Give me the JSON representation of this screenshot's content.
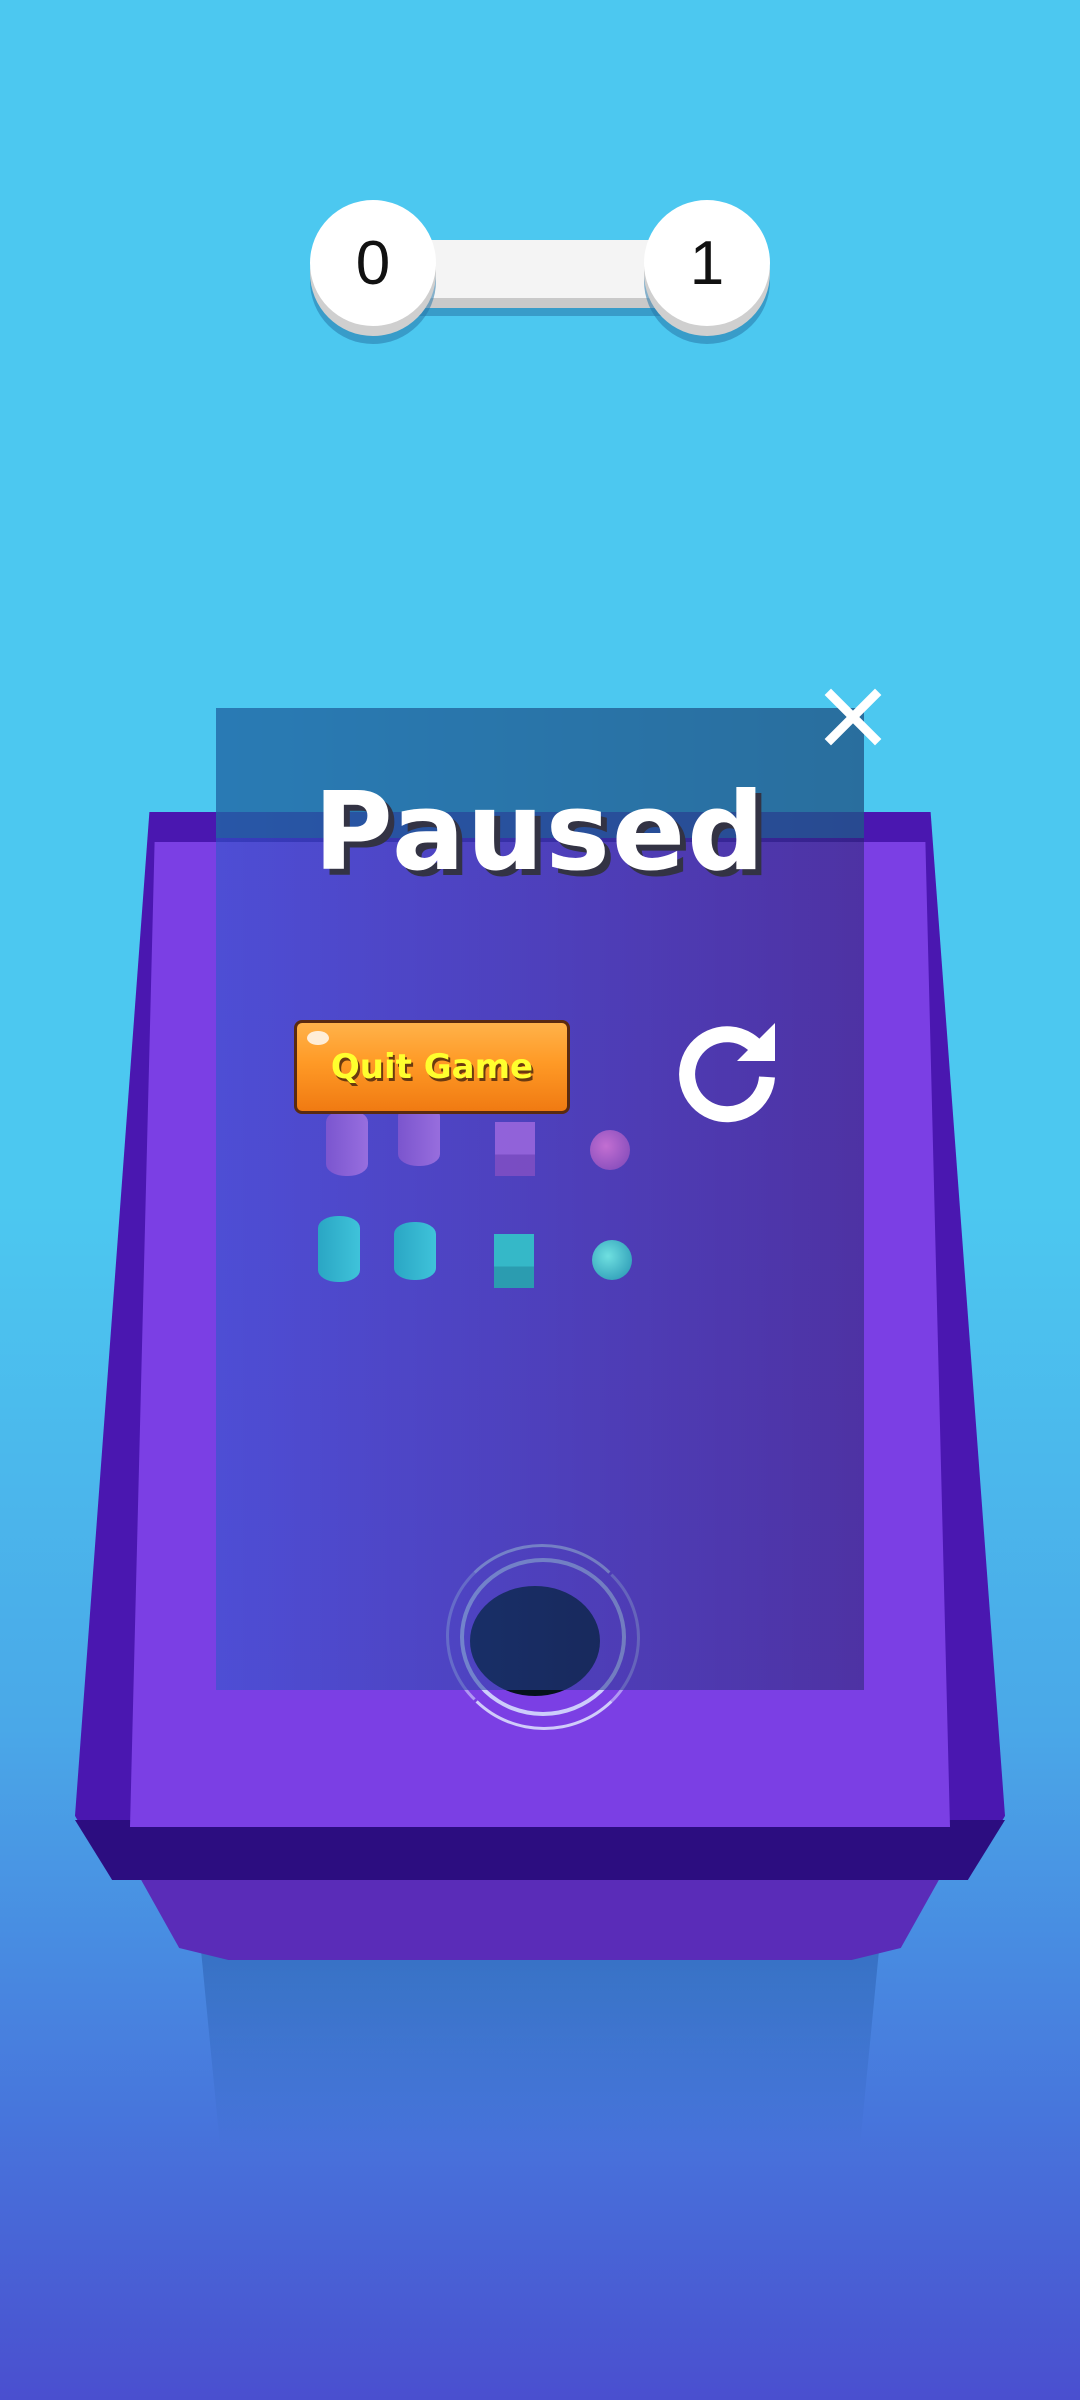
{
  "score": {
    "current_level": "0",
    "next_level": "1"
  },
  "pause_menu": {
    "title": "Paused",
    "quit_button_label": "Quit Game",
    "restart_icon": "restart-icon",
    "close_icon": "close-icon"
  },
  "colors": {
    "sky": "#4cc8f0",
    "tray": "#7b3fe4",
    "quit_button": "#ff9a26",
    "quit_text": "#ffff2e"
  }
}
